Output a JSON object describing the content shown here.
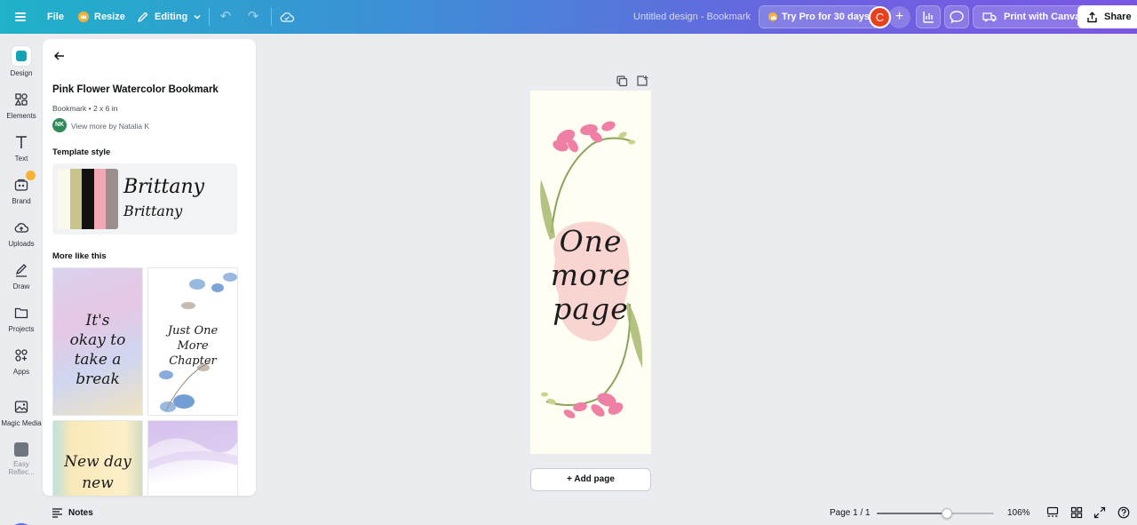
{
  "topbar": {
    "file_label": "File",
    "resize_label": "Resize",
    "editing_label": "Editing",
    "doc_title": "Untitled design - Bookmark",
    "try_pro_label": "Try Pro for 30 days",
    "avatar_initial": "C",
    "print_label": "Print with Canva",
    "share_label": "Share"
  },
  "rail": {
    "items": [
      {
        "label": "Design"
      },
      {
        "label": "Elements"
      },
      {
        "label": "Text"
      },
      {
        "label": "Brand"
      },
      {
        "label": "Uploads"
      },
      {
        "label": "Draw"
      },
      {
        "label": "Projects"
      },
      {
        "label": "Apps"
      },
      {
        "label": "Magic Media"
      },
      {
        "label": "Easy Reflec..."
      }
    ]
  },
  "panel": {
    "template_title": "Pink Flower Watercolor Bookmark",
    "template_subtitle": "Bookmark • 2 x 6 in",
    "author_initials": "NK",
    "view_more": "View more by Natalia K",
    "template_style_heading": "Template style",
    "font_sample_1": "Brittany",
    "font_sample_2": "Brittany",
    "swatch_colors": [
      "#fbf9ec",
      "#c9c48c",
      "#111111",
      "#f1a7b4",
      "#9a8f8d"
    ],
    "more_like_heading": "More like this",
    "thumbs": [
      {
        "text": "It's okay to take a break"
      },
      {
        "text": "Just One More Chapter"
      },
      {
        "text": "New day new"
      },
      {
        "text": ""
      }
    ]
  },
  "canvas": {
    "bookmark_lines": [
      "One",
      "more",
      "page"
    ],
    "add_page_label": "+ Add page"
  },
  "bottombar": {
    "notes_label": "Notes",
    "page_indicator": "Page 1 / 1",
    "zoom_level": "106%",
    "zoom_fraction": 0.6
  },
  "colors": {
    "accent": "#13a3b6",
    "avatar": "#e8401c",
    "pro_crown": "#f9b233",
    "magic_ring": "#5b6ef5"
  }
}
